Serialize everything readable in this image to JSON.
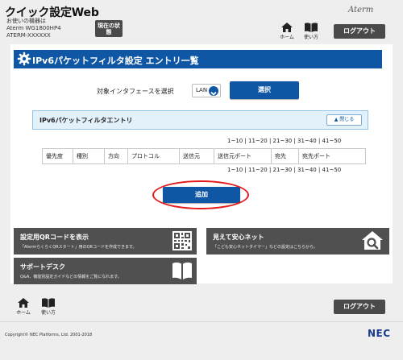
{
  "header": {
    "app_title": "クイック設定Web",
    "device_label": "お使いの機器は",
    "device_model": "Aterm WG1800HP4",
    "device_id": "ATERM-XXXXXX",
    "status_button": "現在の状態",
    "home_label": "ホーム",
    "guide_label": "使い方",
    "brand": "Aterm",
    "logout_label": "ログアウト"
  },
  "page": {
    "title": "IPv6パケットフィルタ設定 エントリ一覧",
    "interface_label": "対象インタフェースを選択",
    "interface_value": "LAN",
    "select_button": "選択",
    "section_title": "IPv6パケットフィルタエントリ",
    "collapse_button": "閉じる",
    "pager": [
      "1~10",
      "11~20",
      "21~30",
      "31~40",
      "41~50"
    ],
    "table_headers": [
      "優先度",
      "種別",
      "方向",
      "プロトコル",
      "送信元",
      "送信元ポート",
      "宛先",
      "宛先ポート"
    ],
    "add_button": "追加"
  },
  "links": {
    "qr_title": "設定用QRコードを表示",
    "qr_desc": "「AtermらくらくQRスタート」用のQRコードを作成できます。",
    "safe_title": "見えて安心ネット",
    "safe_desc": "「こども安心ネットタイマー」などの設定はこちらから。",
    "support_title": "サポートデスク",
    "support_desc": "Q&A、機能別設定ガイドなどの情報をご覧になれます。"
  },
  "footer": {
    "home_label": "ホーム",
    "guide_label": "使い方",
    "logout_label": "ログアウト",
    "copyright": "Copyright© NEC Platforms, Ltd. 2001-2018",
    "logo": "NEC"
  },
  "colors": {
    "primary_blue": "#0f57a5",
    "dark_button": "#4a4a4a",
    "card_gray": "#505050",
    "highlight_red": "#e41a1a",
    "section_bg": "#e3f1fb"
  }
}
